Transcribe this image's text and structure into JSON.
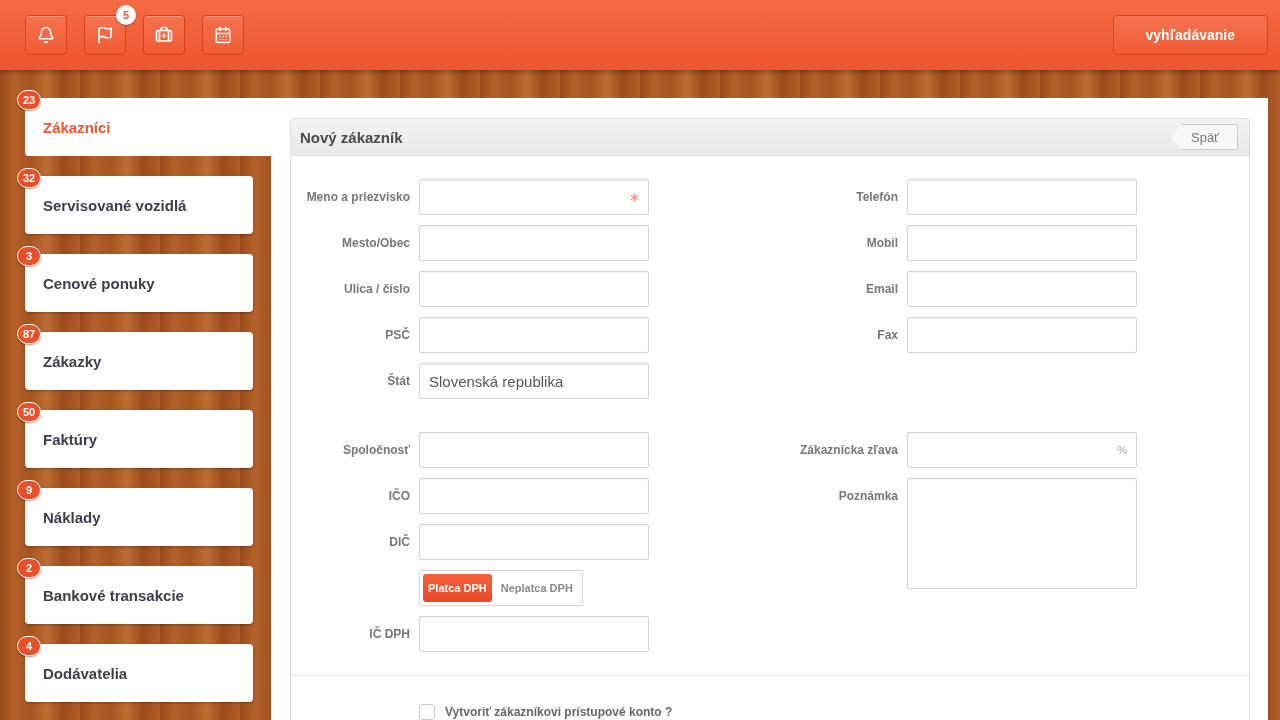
{
  "toolbar": {
    "buttons": [
      {
        "kind": "bell"
      },
      {
        "kind": "flag",
        "badge": "5"
      },
      {
        "kind": "medkit"
      },
      {
        "kind": "calendar"
      }
    ],
    "search_button": "vyhľadávanie"
  },
  "sidebar": {
    "items": [
      {
        "label": "Zákazníci",
        "badge": "23",
        "selected": true
      },
      {
        "label": "Servisované vozidlá",
        "badge": "32",
        "selected": false
      },
      {
        "label": "Cenové ponuky",
        "badge": "3",
        "selected": false
      },
      {
        "label": "Zákazky",
        "badge": "87",
        "selected": false
      },
      {
        "label": "Faktúry",
        "badge": "50",
        "selected": false
      },
      {
        "label": "Náklady",
        "badge": "9",
        "selected": false
      },
      {
        "label": "Bankové transakcie",
        "badge": "2",
        "selected": false
      },
      {
        "label": "Dodávatelia",
        "badge": "4",
        "selected": false
      }
    ]
  },
  "panel": {
    "title": "Nový zákazník",
    "back_button": "Späť",
    "sections": [
      {
        "left": [
          {
            "kind": "input",
            "label": "Meno a priezvisko",
            "required": true
          },
          {
            "kind": "input",
            "label": "Mesto/Obec"
          },
          {
            "kind": "input",
            "label": "Ulica / číslo"
          },
          {
            "kind": "input",
            "label": "PSČ"
          },
          {
            "kind": "input",
            "label": "Štát",
            "value": "Slovenská republika"
          }
        ],
        "right": [
          {
            "kind": "input",
            "label": "Telefón"
          },
          {
            "kind": "input",
            "label": "Mobil"
          },
          {
            "kind": "input",
            "label": "Email"
          },
          {
            "kind": "input",
            "label": "Fax"
          }
        ]
      },
      {
        "left": [
          {
            "kind": "input",
            "label": "Spoločnosť"
          },
          {
            "kind": "input",
            "label": "IČO"
          },
          {
            "kind": "input",
            "label": "DIČ"
          },
          {
            "kind": "toggle",
            "options": [
              {
                "label": "Platca DPH",
                "selected": true
              },
              {
                "label": "Neplatca DPH",
                "selected": false
              }
            ]
          },
          {
            "kind": "input",
            "label": "IČ DPH"
          }
        ],
        "right": [
          {
            "kind": "input",
            "label": "Zákaznícka zľava",
            "suffix": "%"
          },
          {
            "kind": "textarea",
            "label": "Poznámka"
          }
        ]
      }
    ],
    "account_checkbox": {
      "label": "Vytvoriť zákazníkovi prístupové konto ?",
      "checked": false
    }
  }
}
